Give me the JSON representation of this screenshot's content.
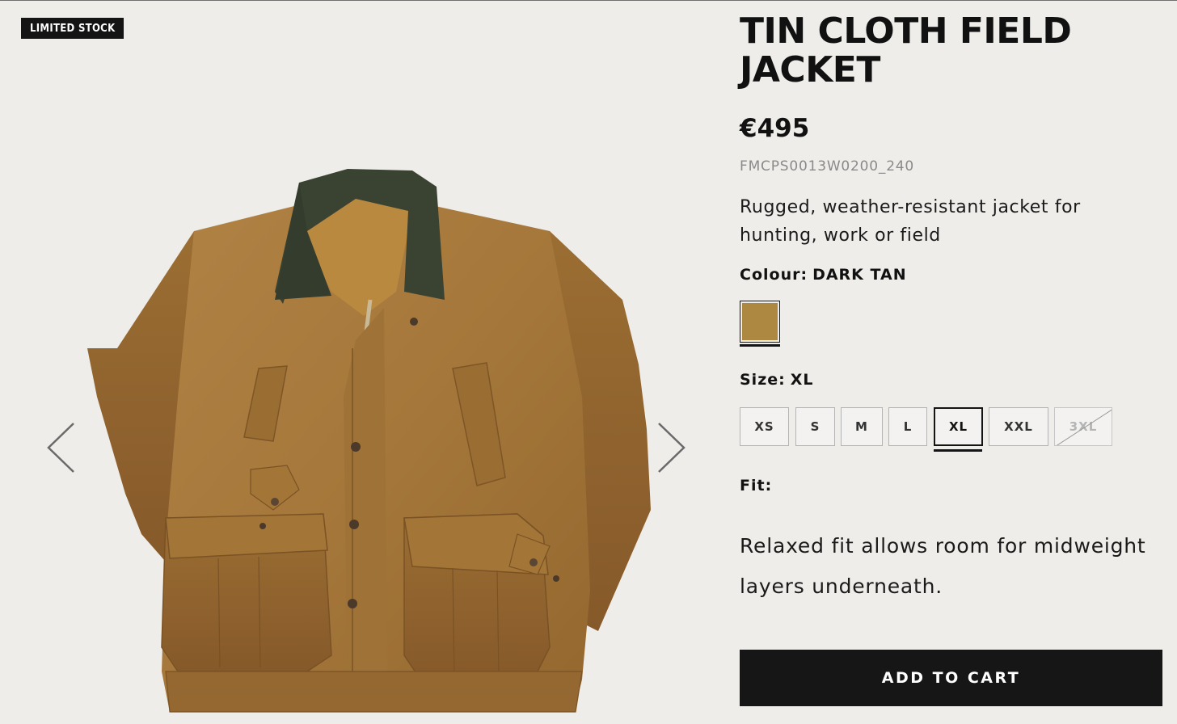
{
  "badge": "LIMITED STOCK",
  "product": {
    "title": "TIN CLOTH FIELD JACKET",
    "price": "€495",
    "sku": "FMCPS0013W0200_240",
    "description": "Rugged, weather-resistant jacket for hunting, work or field"
  },
  "colour": {
    "label": "Colour:",
    "value": "DARK TAN",
    "swatch_color": "#ac8840"
  },
  "size": {
    "label": "Size:",
    "value": "XL",
    "options": [
      "XS",
      "S",
      "M",
      "L",
      "XL",
      "XXL",
      "3XL"
    ],
    "selected": "XL",
    "unavailable": [
      "3XL"
    ]
  },
  "fit": {
    "label": "Fit:",
    "description": "Relaxed fit allows room for midweight layers underneath."
  },
  "cart": {
    "label": "ADD TO CART"
  },
  "gallery": {
    "prev_icon": "chevron-left-icon",
    "next_icon": "chevron-right-icon"
  },
  "colors": {
    "background": "#efedea",
    "button": "#161616",
    "jacket_tan": "#a97a3c",
    "collar": "#3a4232"
  }
}
